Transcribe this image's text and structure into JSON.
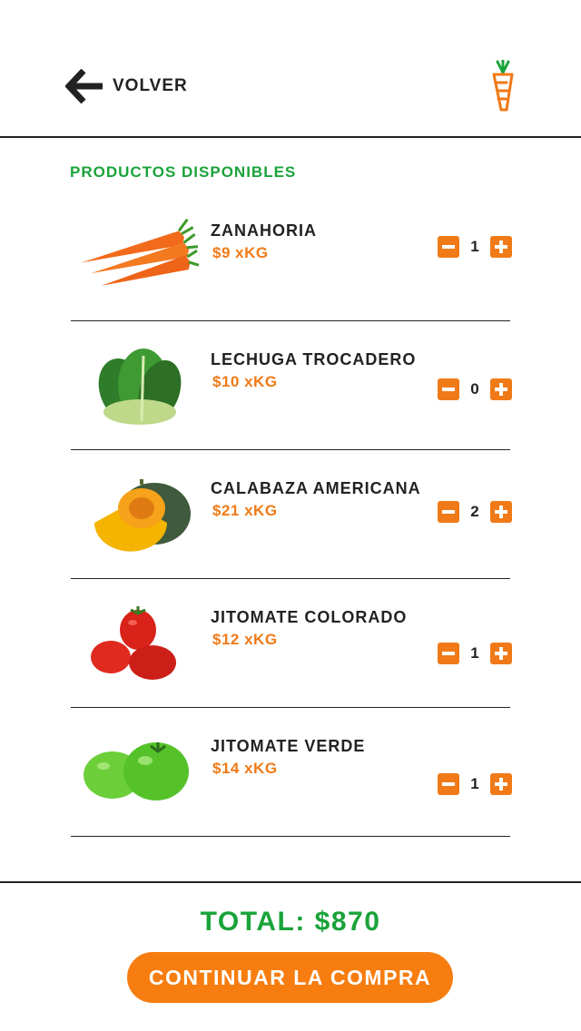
{
  "header": {
    "back_label": "VOLVER",
    "back_icon": "arrow-left-icon",
    "logo_icon": "carrot-logo-icon"
  },
  "section_title": "PRODUCTOS DISPONIBLES",
  "products": [
    {
      "name": "ZANAHORIA",
      "price": "$9 xKG",
      "qty": "1",
      "image": "carrots"
    },
    {
      "name": "LECHUGA TROCADERO",
      "price": "$10 xKG",
      "qty": "0",
      "image": "lettuce"
    },
    {
      "name": "CALABAZA AMERICANA",
      "price": "$21 xKG",
      "qty": "2",
      "image": "pumpkin"
    },
    {
      "name": "JITOMATE COLORADO",
      "price": "$12 xKG",
      "qty": "1",
      "image": "red-tomatoes"
    },
    {
      "name": "JITOMATE VERDE",
      "price": "$14 xKG",
      "qty": "1",
      "image": "green-tomatoes"
    }
  ],
  "footer": {
    "total": "TOTAL: $870",
    "cta_label": "CONTINUAR LA COMPRA"
  },
  "colors": {
    "accent_orange": "#f07a17",
    "accent_green": "#1aa33a",
    "text_dark": "#222222"
  }
}
